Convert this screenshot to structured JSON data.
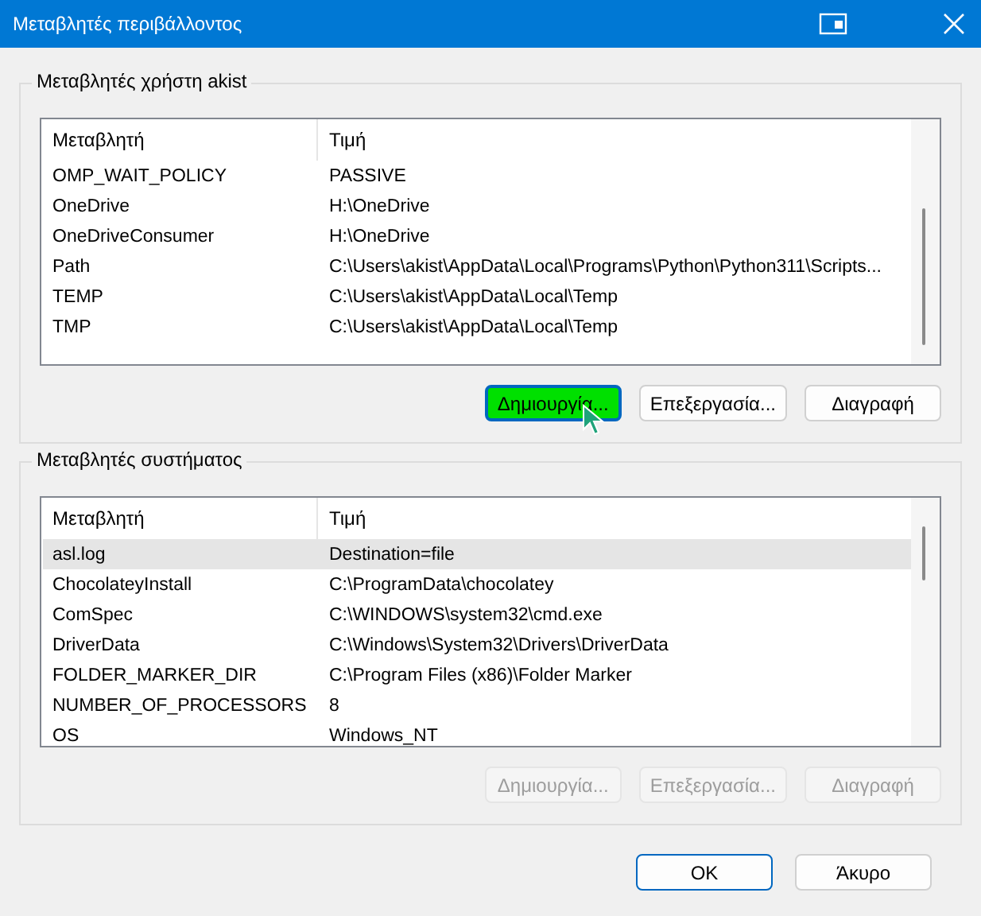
{
  "window": {
    "title": "Μεταβλητές περιβάλλοντος"
  },
  "groups": [
    {
      "title": "Μεταβλητές χρήστη akist",
      "columns": [
        "Μεταβλητή",
        "Τιμή"
      ],
      "rows": [
        {
          "name": "OMP_WAIT_POLICY",
          "value": "PASSIVE",
          "selected": false
        },
        {
          "name": "OneDrive",
          "value": "H:\\OneDrive",
          "selected": false
        },
        {
          "name": "OneDriveConsumer",
          "value": "H:\\OneDrive",
          "selected": false
        },
        {
          "name": "Path",
          "value": "C:\\Users\\akist\\AppData\\Local\\Programs\\Python\\Python311\\Scripts...",
          "selected": false
        },
        {
          "name": "TEMP",
          "value": "C:\\Users\\akist\\AppData\\Local\\Temp",
          "selected": false
        },
        {
          "name": "TMP",
          "value": "C:\\Users\\akist\\AppData\\Local\\Temp",
          "selected": false
        }
      ],
      "buttons": [
        {
          "label": "Δημιουργία...",
          "disabled": false,
          "highlighted": true
        },
        {
          "label": "Επεξεργασία...",
          "disabled": false,
          "highlighted": false
        },
        {
          "label": "Διαγραφή",
          "disabled": false,
          "highlighted": false
        }
      ]
    },
    {
      "title": "Μεταβλητές συστήματος",
      "columns": [
        "Μεταβλητή",
        "Τιμή"
      ],
      "rows": [
        {
          "name": "asl.log",
          "value": "Destination=file",
          "selected": true
        },
        {
          "name": "ChocolateyInstall",
          "value": "C:\\ProgramData\\chocolatey",
          "selected": false
        },
        {
          "name": "ComSpec",
          "value": "C:\\WINDOWS\\system32\\cmd.exe",
          "selected": false
        },
        {
          "name": "DriverData",
          "value": "C:\\Windows\\System32\\Drivers\\DriverData",
          "selected": false
        },
        {
          "name": "FOLDER_MARKER_DIR",
          "value": "C:\\Program Files (x86)\\Folder Marker",
          "selected": false
        },
        {
          "name": "NUMBER_OF_PROCESSORS",
          "value": "8",
          "selected": false
        },
        {
          "name": "OS",
          "value": "Windows_NT",
          "selected": false
        }
      ],
      "buttons": [
        {
          "label": "Δημιουργία...",
          "disabled": true,
          "highlighted": false
        },
        {
          "label": "Επεξεργασία...",
          "disabled": true,
          "highlighted": false
        },
        {
          "label": "Διαγραφή",
          "disabled": true,
          "highlighted": false
        }
      ]
    }
  ],
  "dialog_buttons": [
    {
      "label": "OK",
      "default": true
    },
    {
      "label": "Άκυρο",
      "default": false
    }
  ]
}
